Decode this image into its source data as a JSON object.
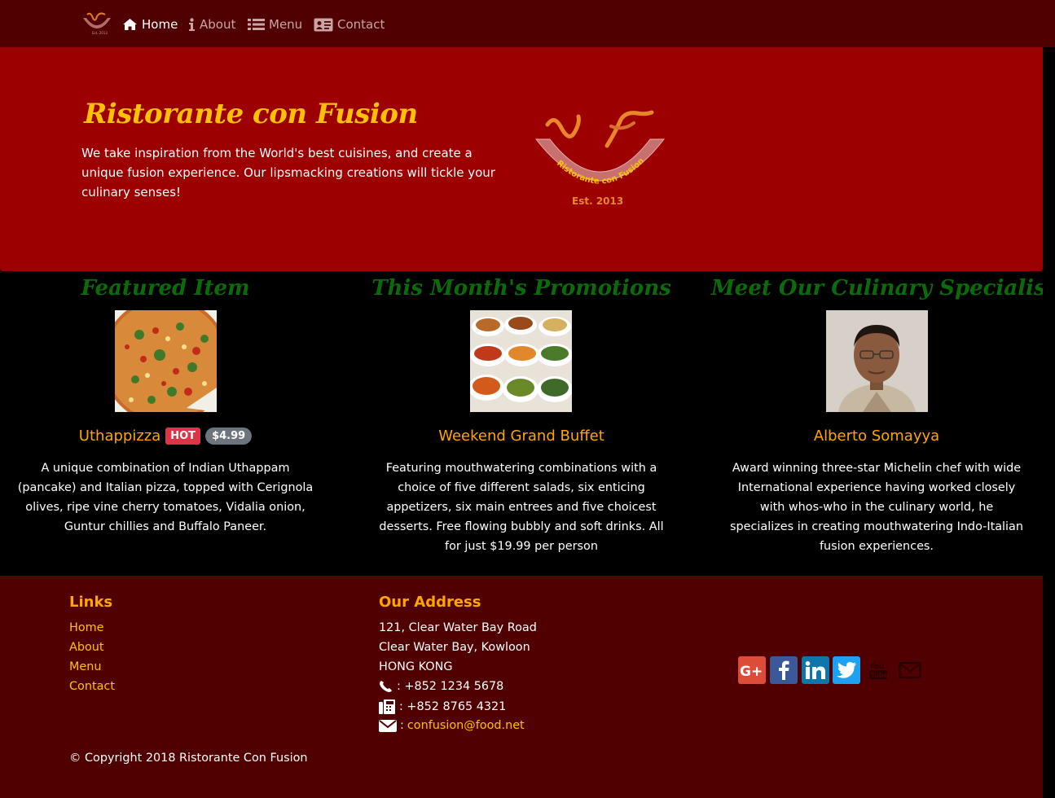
{
  "nav": {
    "items": [
      {
        "label": "Home",
        "icon": "home-icon"
      },
      {
        "label": "About",
        "icon": "info-icon"
      },
      {
        "label": "Menu",
        "icon": "list-icon"
      },
      {
        "label": "Contact",
        "icon": "address-card-icon"
      }
    ]
  },
  "jumbotron": {
    "title": "Ristorante con Fusion",
    "text": "We take inspiration from the World's best cuisines, and create a unique fusion experience. Our lipsmacking creations will tickle your culinary senses!",
    "logo_text": "Ristorante con Fusion",
    "logo_year": "Est. 2013"
  },
  "featured": {
    "title": "Featured Item",
    "name": "Uthappizza",
    "badge": "HOT",
    "price": "$4.99",
    "description": "A unique combination of Indian Uthappam (pancake) and Italian pizza, topped with Cerignola olives, ripe vine cherry tomatoes, Vidalia onion, Guntur chillies and Buffalo Paneer."
  },
  "promotion": {
    "title": "This Month's Promotions",
    "name": "Weekend Grand Buffet",
    "description": "Featuring mouthwatering combinations with a choice of five different salads, six enticing appetizers, six main entrees and five choicest desserts. Free flowing bubbly and soft drinks. All for just $19.99 per person"
  },
  "leader": {
    "title": "Meet Our Culinary Specialist",
    "name": "Alberto Somayya",
    "description": "Award winning three-star Michelin chef with wide International experience having worked closely with whos-who in the culinary world, he specializes in creating mouthwatering Indo-Italian fusion experiences."
  },
  "footer": {
    "links_heading": "Links",
    "links": [
      "Home",
      "About",
      "Menu",
      "Contact"
    ],
    "address_heading": "Our Address",
    "address_lines": [
      "121, Clear Water Bay Road",
      "Clear Water Bay, Kowloon",
      "HONG KONG"
    ],
    "phone": ": +852 1234 5678",
    "fax": ": +852 8765 4321",
    "email_prefix": ": ",
    "email": "confusion@food.net",
    "social": [
      "google-plus-icon",
      "facebook-icon",
      "linkedin-icon",
      "twitter-icon",
      "youtube-icon",
      "mail-icon"
    ],
    "copyright": "© Copyright 2018 Ristorante Con Fusion"
  },
  "colors": {
    "navbar": "#500000",
    "jumbotron": "#9d0000",
    "accent_yellow": "#ffc107",
    "accent_orange": "#ffa500",
    "section_title_green": "#0b6b0b",
    "hot_badge": "#dc3545",
    "price_badge": "#6c757d"
  }
}
